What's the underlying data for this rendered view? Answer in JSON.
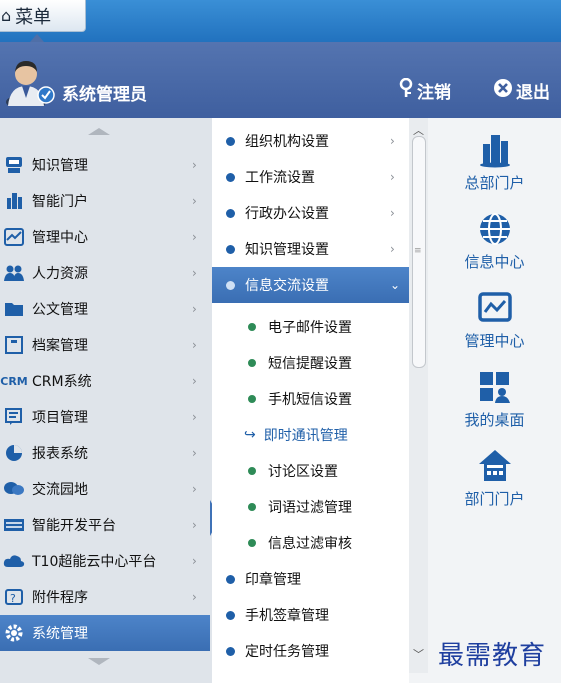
{
  "topbar": {
    "menu_label": "菜单",
    "home_icon": "home-icon"
  },
  "header": {
    "username": "系统管理员",
    "logout_label": "注销",
    "exit_label": "退出"
  },
  "level1": [
    {
      "label": "知识管理",
      "icon": "knowledge-icon"
    },
    {
      "label": "智能门户",
      "icon": "portal-icon"
    },
    {
      "label": "管理中心",
      "icon": "chart-icon"
    },
    {
      "label": "人力资源",
      "icon": "people-icon"
    },
    {
      "label": "公文管理",
      "icon": "folder-icon"
    },
    {
      "label": "档案管理",
      "icon": "archive-icon"
    },
    {
      "label": "CRM系统",
      "icon": "crm-icon"
    },
    {
      "label": "项目管理",
      "icon": "project-icon"
    },
    {
      "label": "报表系统",
      "icon": "pie-icon"
    },
    {
      "label": "交流园地",
      "icon": "chat-icon"
    },
    {
      "label": "智能开发平台",
      "icon": "dev-icon"
    },
    {
      "label": "T10超能云中心平台",
      "icon": "cloud-icon"
    },
    {
      "label": "附件程序",
      "icon": "attachment-icon"
    },
    {
      "label": "系统管理",
      "icon": "gear-icon"
    }
  ],
  "level2": [
    {
      "label": "组织机构设置"
    },
    {
      "label": "工作流设置"
    },
    {
      "label": "行政办公设置"
    },
    {
      "label": "知识管理设置"
    },
    {
      "label": "信息交流设置"
    }
  ],
  "level3": [
    {
      "label": "电子邮件设置"
    },
    {
      "label": "短信提醒设置"
    },
    {
      "label": "手机短信设置"
    },
    {
      "label": "即时通讯管理"
    },
    {
      "label": "讨论区设置"
    },
    {
      "label": "词语过滤管理"
    },
    {
      "label": "信息过滤审核"
    }
  ],
  "level2_after": [
    {
      "label": "印章管理"
    },
    {
      "label": "手机签章管理"
    },
    {
      "label": "定时任务管理"
    }
  ],
  "quick": [
    {
      "label": "总部门户",
      "icon": "building-icon"
    },
    {
      "label": "信息中心",
      "icon": "globe-icon"
    },
    {
      "label": "管理中心",
      "icon": "chart-icon"
    },
    {
      "label": "我的桌面",
      "icon": "desktop-icon"
    },
    {
      "label": "部门门户",
      "icon": "house-icon"
    }
  ],
  "watermark": "最需教育"
}
